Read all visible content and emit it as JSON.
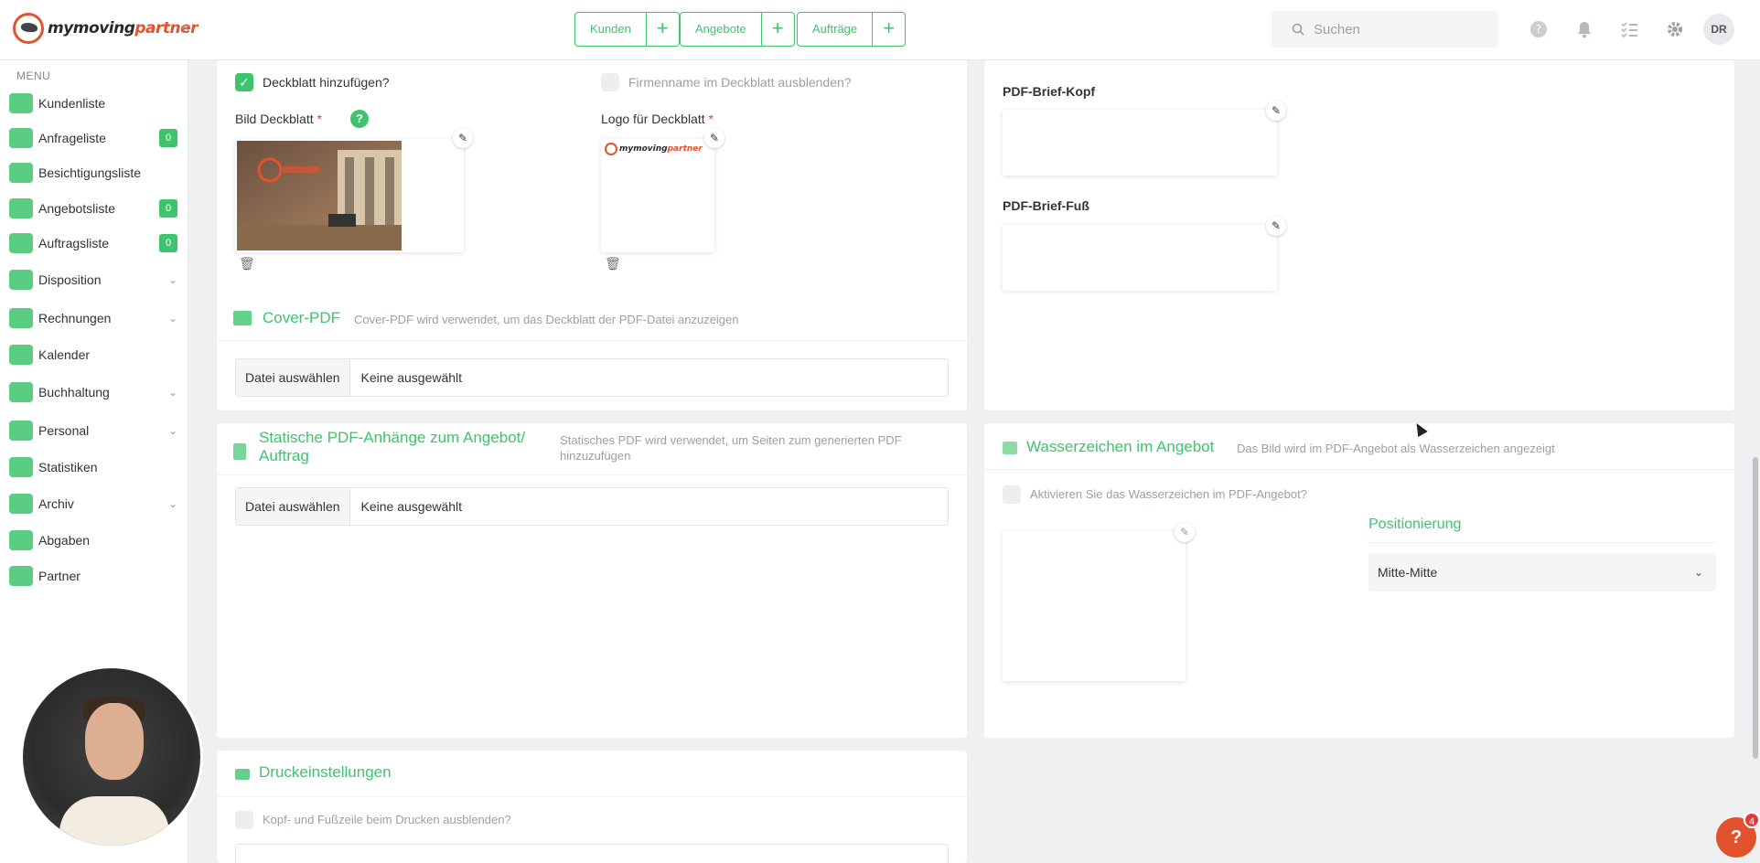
{
  "brand": {
    "logo_part1": "mymoving",
    "logo_part2": "partner"
  },
  "topbar": {
    "quick_actions": [
      {
        "label": "Kunden"
      },
      {
        "label": "Angebote"
      },
      {
        "label": "Aufträge"
      }
    ],
    "plus_symbol": "+",
    "search_placeholder": "Suchen",
    "avatar_initials": "DR"
  },
  "sidebar": {
    "header": "MENU",
    "items": [
      {
        "label": "Kundenliste"
      },
      {
        "label": "Anfrageliste",
        "badge": "0"
      },
      {
        "label": "Besichtigungsliste"
      },
      {
        "label": "Angebotsliste",
        "badge": "0"
      },
      {
        "label": "Auftragsliste",
        "badge": "0"
      },
      {
        "label": "Disposition"
      },
      {
        "label": "Rechnungen"
      },
      {
        "label": "Kalender"
      },
      {
        "label": "Buchhaltung"
      },
      {
        "label": "Personal"
      },
      {
        "label": "Statistiken"
      },
      {
        "label": "Archiv"
      },
      {
        "label": "Abgaben"
      },
      {
        "label": "Partner"
      }
    ]
  },
  "cover": {
    "add_cover_label": "Deckblatt hinzufügen?",
    "hide_company_label": "Firmenname im Deckblatt ausblenden?",
    "image_label": "Bild Deckblatt",
    "logo_label": "Logo für Deckblatt",
    "required_mark": "*",
    "help_mark": "?"
  },
  "cover_pdf": {
    "title": "Cover-PDF",
    "subtitle": "Cover-PDF wird verwendet, um das Deckblatt der PDF-Datei anzuzeigen",
    "file_button": "Datei auswählen",
    "file_value": "Keine ausgewählt"
  },
  "pdf_letter": {
    "header_label": "PDF-Brief-Kopf",
    "footer_label": "PDF-Brief-Fuß"
  },
  "static_pdf": {
    "title_line1": "Statische PDF-Anhänge zum Angebot/",
    "title_line2": "Auftrag",
    "subtitle_line1": "Statisches PDF wird verwendet, um Seiten zum generierten PDF",
    "subtitle_line2": "hinzuzufügen",
    "file_button": "Datei auswählen",
    "file_value": "Keine ausgewählt"
  },
  "watermark": {
    "title": "Wasserzeichen im Angebot",
    "subtitle": "Das Bild wird im PDF-Angebot als Wasserzeichen angezeigt",
    "activate_label": "Aktivieren Sie das Wasserzeichen im PDF-Angebot?",
    "position_title": "Positionierung",
    "position_value": "Mitte-Mitte"
  },
  "print": {
    "title": "Druckeinstellungen",
    "hide_header_footer_label": "Kopf- und Fußzeile beim Drucken ausblenden?"
  },
  "help_fab": {
    "label": "?",
    "badge": "4"
  }
}
